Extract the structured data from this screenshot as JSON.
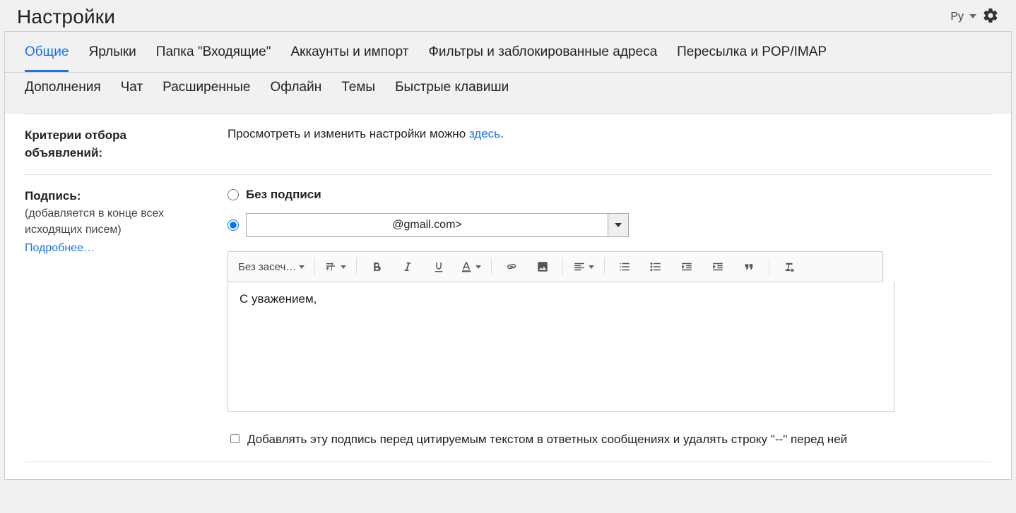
{
  "header": {
    "title": "Настройки",
    "language": "Ру"
  },
  "tabs": {
    "row1": [
      "Общие",
      "Ярлыки",
      "Папка \"Входящие\"",
      "Аккаунты и импорт",
      "Фильтры и заблокированные адреса",
      "Пересылка и POP/IMAP"
    ],
    "row2": [
      "Дополнения",
      "Чат",
      "Расширенные",
      "Офлайн",
      "Темы",
      "Быстрые клавиши"
    ],
    "active": "Общие"
  },
  "ad_criteria": {
    "label": "Критерии отбора объявлений:",
    "text_before": "Просмотреть и изменить настройки можно ",
    "link": "здесь",
    "text_after": "."
  },
  "signature": {
    "label": "Подпись:",
    "sub": "(добавляется в конце всех исходящих писем)",
    "learn_more": "Подробнее…",
    "option_none": "Без подписи",
    "account": "@gmail.com>",
    "editor_text": "С уважением,",
    "checkbox_text": "Добавлять эту подпись перед цитируемым текстом в ответных сообщениях и удалять строку \"--\" перед ней",
    "toolbar": {
      "font_label": "Без засеч…"
    }
  }
}
